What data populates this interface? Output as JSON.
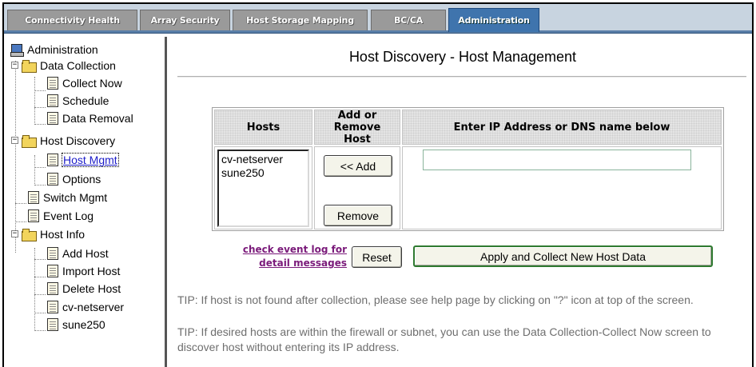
{
  "tabs": [
    {
      "label": "Connectivity Health",
      "active": false
    },
    {
      "label": "Array Security",
      "active": false
    },
    {
      "label": "Host Storage Mapping",
      "active": false
    },
    {
      "label": "BC/CA",
      "active": false
    },
    {
      "label": "Administration",
      "active": true
    }
  ],
  "tree": {
    "root": "Administration",
    "data_collection": {
      "label": "Data Collection",
      "items": [
        "Collect Now",
        "Schedule",
        "Data Removal"
      ]
    },
    "host_discovery": {
      "label": "Host Discovery",
      "items": [
        "Host Mgmt",
        "Options"
      ],
      "selected": "Host Mgmt"
    },
    "switch_mgmt": "Switch Mgmt",
    "event_log": "Event Log",
    "host_info": {
      "label": "Host Info",
      "items": [
        "Add Host",
        "Import Host",
        "Delete Host",
        "cv-netserver",
        "sune250"
      ]
    }
  },
  "main": {
    "title": "Host Discovery - Host Management",
    "table": {
      "headers": [
        "Hosts",
        "Add or Remove Host",
        "Enter IP Address or DNS name below"
      ],
      "hosts": [
        "cv-netserver",
        "sune250"
      ],
      "add_label": "<< Add",
      "remove_label": "Remove",
      "ip_value": ""
    },
    "event_log_link": "check event log for detail messages",
    "reset_label": "Reset",
    "apply_label": "Apply and Collect New Host Data",
    "tip1": "TIP: If host is not found after collection, please see help page by clicking on \"?\" icon at top of the screen.",
    "tip2": "TIP: If desired hosts are within the firewall or subnet, you can use the Data Collection-Collect Now screen to discover host without entering its IP address."
  },
  "colors": {
    "active_tab": "#3f74ad",
    "inactive_tab": "#9a9a9a",
    "link_visited": "#7a1a7a",
    "tree_link": "#1c1cc8",
    "apply_border": "#2f7a30"
  }
}
